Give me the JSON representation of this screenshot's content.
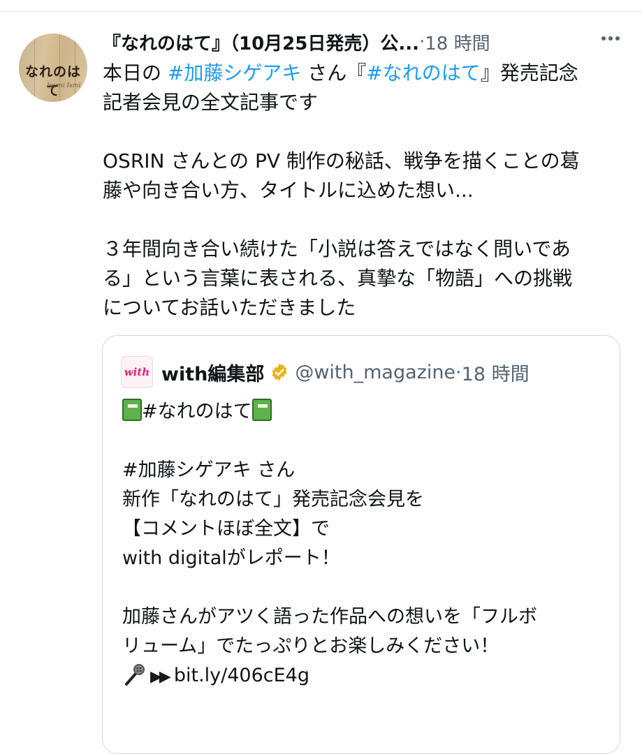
{
  "tweet": {
    "avatar_text": "なれのはて",
    "avatar_signature": "Iyumi Ismi",
    "display_name": "『なれのはて』（10月25日発売）公...",
    "separator": "·",
    "time": "18 時間",
    "lines": [
      {
        "parts": [
          {
            "t": "本日の ",
            "tag": false
          },
          {
            "t": "#加藤シゲアキ",
            "tag": true
          },
          {
            "t": " さん『",
            "tag": false
          },
          {
            "t": "#なれのはて",
            "tag": true
          },
          {
            "t": "』発売記念",
            "tag": false
          }
        ]
      },
      {
        "parts": [
          {
            "t": "記者会見の全文記事です",
            "tag": false
          }
        ]
      },
      {
        "parts": []
      },
      {
        "parts": [
          {
            "t": "OSRIN さんとの PV 制作の秘話、戦争を描くことの葛",
            "tag": false
          }
        ]
      },
      {
        "parts": [
          {
            "t": "藤や向き合い方、タイトルに込めた想い...",
            "tag": false
          }
        ]
      },
      {
        "parts": []
      },
      {
        "parts": [
          {
            "t": "３年間向き合い続けた「小説は答えではなく問いであ",
            "tag": false
          }
        ]
      },
      {
        "parts": [
          {
            "t": "る」という言葉に表される、真摯な「物語」への挑戦",
            "tag": false
          }
        ]
      },
      {
        "parts": [
          {
            "t": "についてお話いただきました",
            "tag": false
          }
        ]
      }
    ]
  },
  "quote": {
    "avatar_text": "with",
    "name": "with編集部",
    "handle": "@with_magazine",
    "separator": "·",
    "time": "18 時間",
    "icons": [
      "book-icon",
      "verified-icon",
      "mic-icon",
      "play-icon"
    ],
    "first_line": "#なれのはて",
    "lines": [
      "",
      "#加藤シゲアキ さん",
      "新作「なれのはて」発売記念会見を",
      "【コメントほぼ全文】で",
      "with digitalがレポート！",
      "",
      "加藤さんがアツく語った作品への想いを「フルボ",
      "リューム」でたっぷりとお楽しみください！"
    ],
    "link_arrows": "▶▶",
    "link": "bit.ly/406cE4g"
  },
  "colors": {
    "link": "#1d9bf0",
    "muted": "#536471",
    "border": "#cfd9de",
    "verified": "#e8b21d"
  }
}
